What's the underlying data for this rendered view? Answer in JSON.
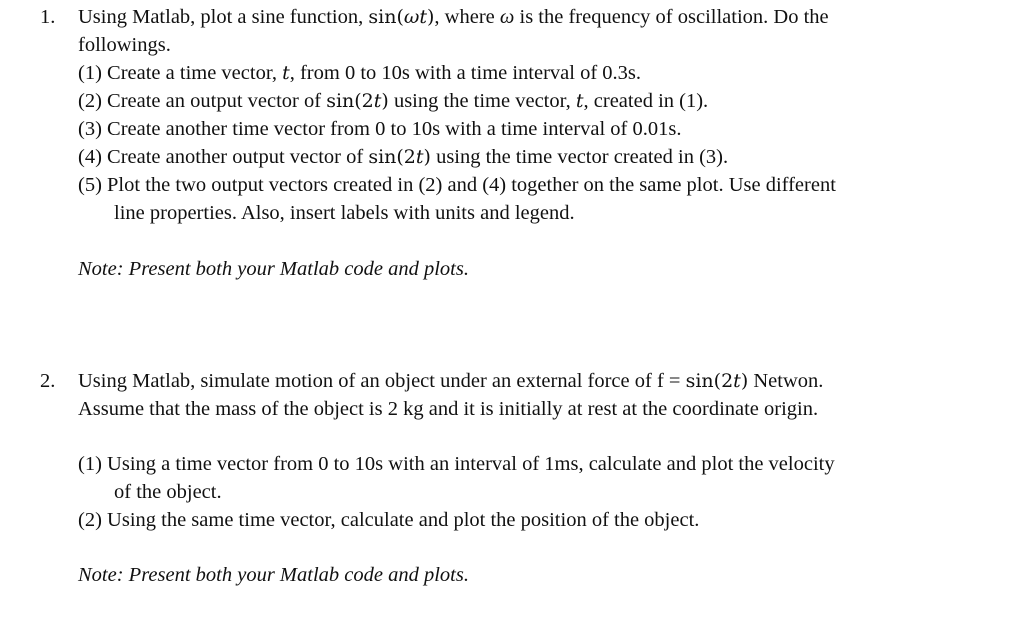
{
  "questions": [
    {
      "number": "1.",
      "intro_line1_a": "Using Matlab, plot a sine function, ",
      "intro_line1_math": "sin(",
      "intro_line1_math_var": "ωt",
      "intro_line1_math_close": ")",
      "intro_line1_b": ", where ",
      "intro_line1_omega": "ω",
      "intro_line1_c": " is the frequency of oscillation. Do the",
      "intro_line2": "followings.",
      "steps": [
        {
          "label": "(1)",
          "a": " Create a time vector, ",
          "var": "t",
          "b": ", from 0 to 10s with a time interval of 0.3s."
        },
        {
          "label": "(2)",
          "a": " Create an output vector of ",
          "math": "sin(2",
          "var": "t",
          "math_close": ")",
          "b": " using the time vector, ",
          "var2": "t",
          "c": ", created in (1)."
        },
        {
          "label": "(3)",
          "a": " Create another time vector from 0 to 10s with a time interval of 0.01s."
        },
        {
          "label": "(4)",
          "a": " Create another output vector of ",
          "math": "sin(2",
          "var": "t",
          "math_close": ")",
          "b": " using the time vector created in (3)."
        },
        {
          "label": "(5)",
          "a": " Plot the two output vectors created in (2) and (4) together on the same plot. Use different",
          "cont": "line properties. Also, insert labels with units and legend."
        }
      ],
      "note": "Note: Present both your Matlab code and plots."
    },
    {
      "number": "2.",
      "intro_line1_a": "Using Matlab, simulate motion of an object under an external force of f = ",
      "intro_line1_math": "sin(2",
      "intro_line1_math_var": "t",
      "intro_line1_math_close": ")",
      "intro_line1_b": " Netwon.",
      "intro_line2": "Assume that the mass of the object is 2 kg and it is initially at rest at the coordinate origin.",
      "steps": [
        {
          "label": "(1)",
          "a": " Using a time vector from 0 to 10s with an interval of 1ms, calculate and plot the velocity",
          "cont": "of the object."
        },
        {
          "label": "(2)",
          "a": " Using the same time vector, calculate and plot the position of the object."
        }
      ],
      "note": "Note: Present both your Matlab code and plots."
    }
  ]
}
